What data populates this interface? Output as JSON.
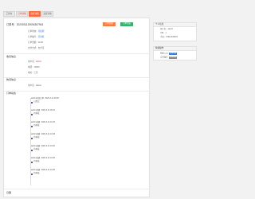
{
  "tabs": [
    "工作台",
    "订单详情",
    "出库详情",
    "退货详情"
  ],
  "header": {
    "order_title": "订单号：2020031120094367943",
    "btn_primary": "订单处理",
    "btn_secondary": "订单完成"
  },
  "order_info": {
    "fields": [
      {
        "label": "订单状态:",
        "value": "待处理",
        "color": "blue"
      },
      {
        "label": "订单编号:",
        "value": "待审核",
        "color": "blue"
      },
      {
        "label": "订单金额:",
        "value": "¥0.00",
        "color": "normal"
      },
      {
        "label": "支付方式:",
        "value": "支付宝",
        "color": "normal"
      }
    ]
  },
  "sections": {
    "receiver": "收货信息",
    "delivery": "物流信息",
    "timeline": "订单动态",
    "footer": "日期"
  },
  "receiver": {
    "fields": [
      {
        "label": "用户名:",
        "value": "admin",
        "color": "red"
      },
      {
        "label": "电话:",
        "value": "13800",
        "color": "normal"
      },
      {
        "label": "地址:",
        "value": "江苏",
        "color": "normal"
      }
    ]
  },
  "delivery": {
    "fields": [
      {
        "label": "用户名:",
        "value": "admin",
        "color": "normal"
      }
    ]
  },
  "timeline": [
    {
      "actor": "admin修改订单",
      "time": "2020-3-11 09:00",
      "status": "已提交"
    },
    {
      "actor": "admin创建",
      "time": "2020-3-11 09:12",
      "status": "待审核"
    },
    {
      "actor": "admin创建",
      "time": "2020-3-11 10:15",
      "status": "待审核"
    },
    {
      "actor": "admin创建",
      "time": "2020-3-11 10:18",
      "status": "待审核"
    },
    {
      "actor": "admin创建",
      "time": "2020-3-11 10:20",
      "status": "待审核"
    },
    {
      "actor": "admin创建",
      "time": "2020-3-11 10:25",
      "status": "待审核"
    },
    {
      "actor": "admin创建",
      "time": "2020-3-11 10:30",
      "status": "待审核"
    }
  ],
  "side_user": {
    "title": "个人信息",
    "rows": [
      "用户名：admin",
      "UID：1",
      "手机：15812345678"
    ]
  },
  "side_ops": {
    "title": "快捷操作",
    "rows": [
      {
        "label": "快捷入口:",
        "btn": "快速审核"
      },
      {
        "label": "订单操作:",
        "btn": "快速审核"
      }
    ]
  },
  "colors": {
    "accent": "#ff6b3d",
    "success": "#34b36b",
    "link": "#2b7be0",
    "danger": "#e23b3b"
  }
}
